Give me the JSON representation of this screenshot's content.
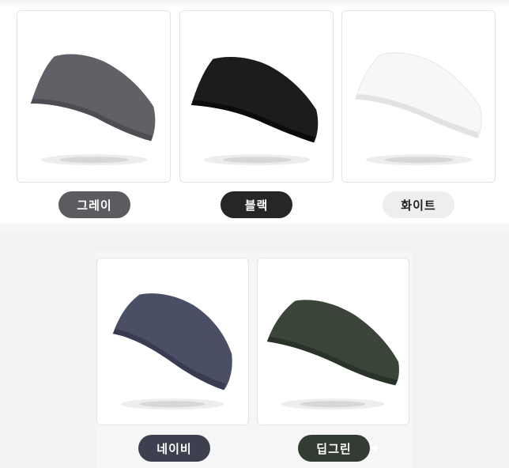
{
  "products": [
    {
      "label": "그레이",
      "band_color": "#5f6166",
      "band_shadow": "#4c4e53",
      "pill_bg": "#5b5b60",
      "pill_style": "dark"
    },
    {
      "label": "블랙",
      "band_color": "#1c1c1c",
      "band_shadow": "#0b0b0b",
      "pill_bg": "#262626",
      "pill_style": "dark"
    },
    {
      "label": "화이트",
      "band_color": "#f7f7f7",
      "band_shadow": "#e2e2e2",
      "pill_bg": "#eeeeee",
      "pill_style": "light"
    },
    {
      "label": "네이비",
      "band_color": "#4b4f66",
      "band_shadow": "#393c50",
      "pill_bg": "#3e4050",
      "pill_style": "dark"
    },
    {
      "label": "딥그린",
      "band_color": "#3a4438",
      "band_shadow": "#2a3329",
      "pill_bg": "#333c32",
      "pill_style": "dark"
    }
  ]
}
